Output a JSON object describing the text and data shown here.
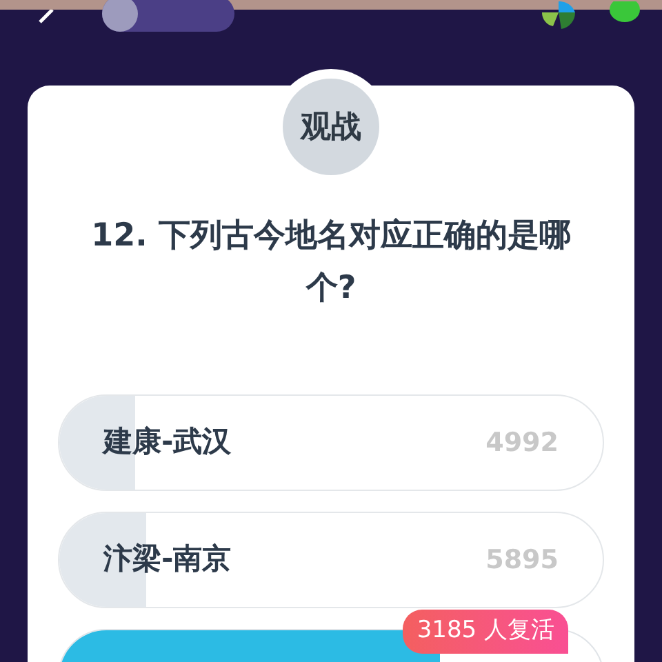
{
  "spectate_tab": {
    "label": "观战"
  },
  "question": {
    "text": "12. 下列古今地名对应正确的是哪个?"
  },
  "options": [
    {
      "label": "建康-武汉",
      "count": "4992",
      "level": 0.14,
      "selected": false
    },
    {
      "label": "汴梁-南京",
      "count": "5895",
      "level": 0.16,
      "selected": false
    },
    {
      "level": 0.7,
      "selected": true,
      "badge": "3185 人复活"
    }
  ]
}
